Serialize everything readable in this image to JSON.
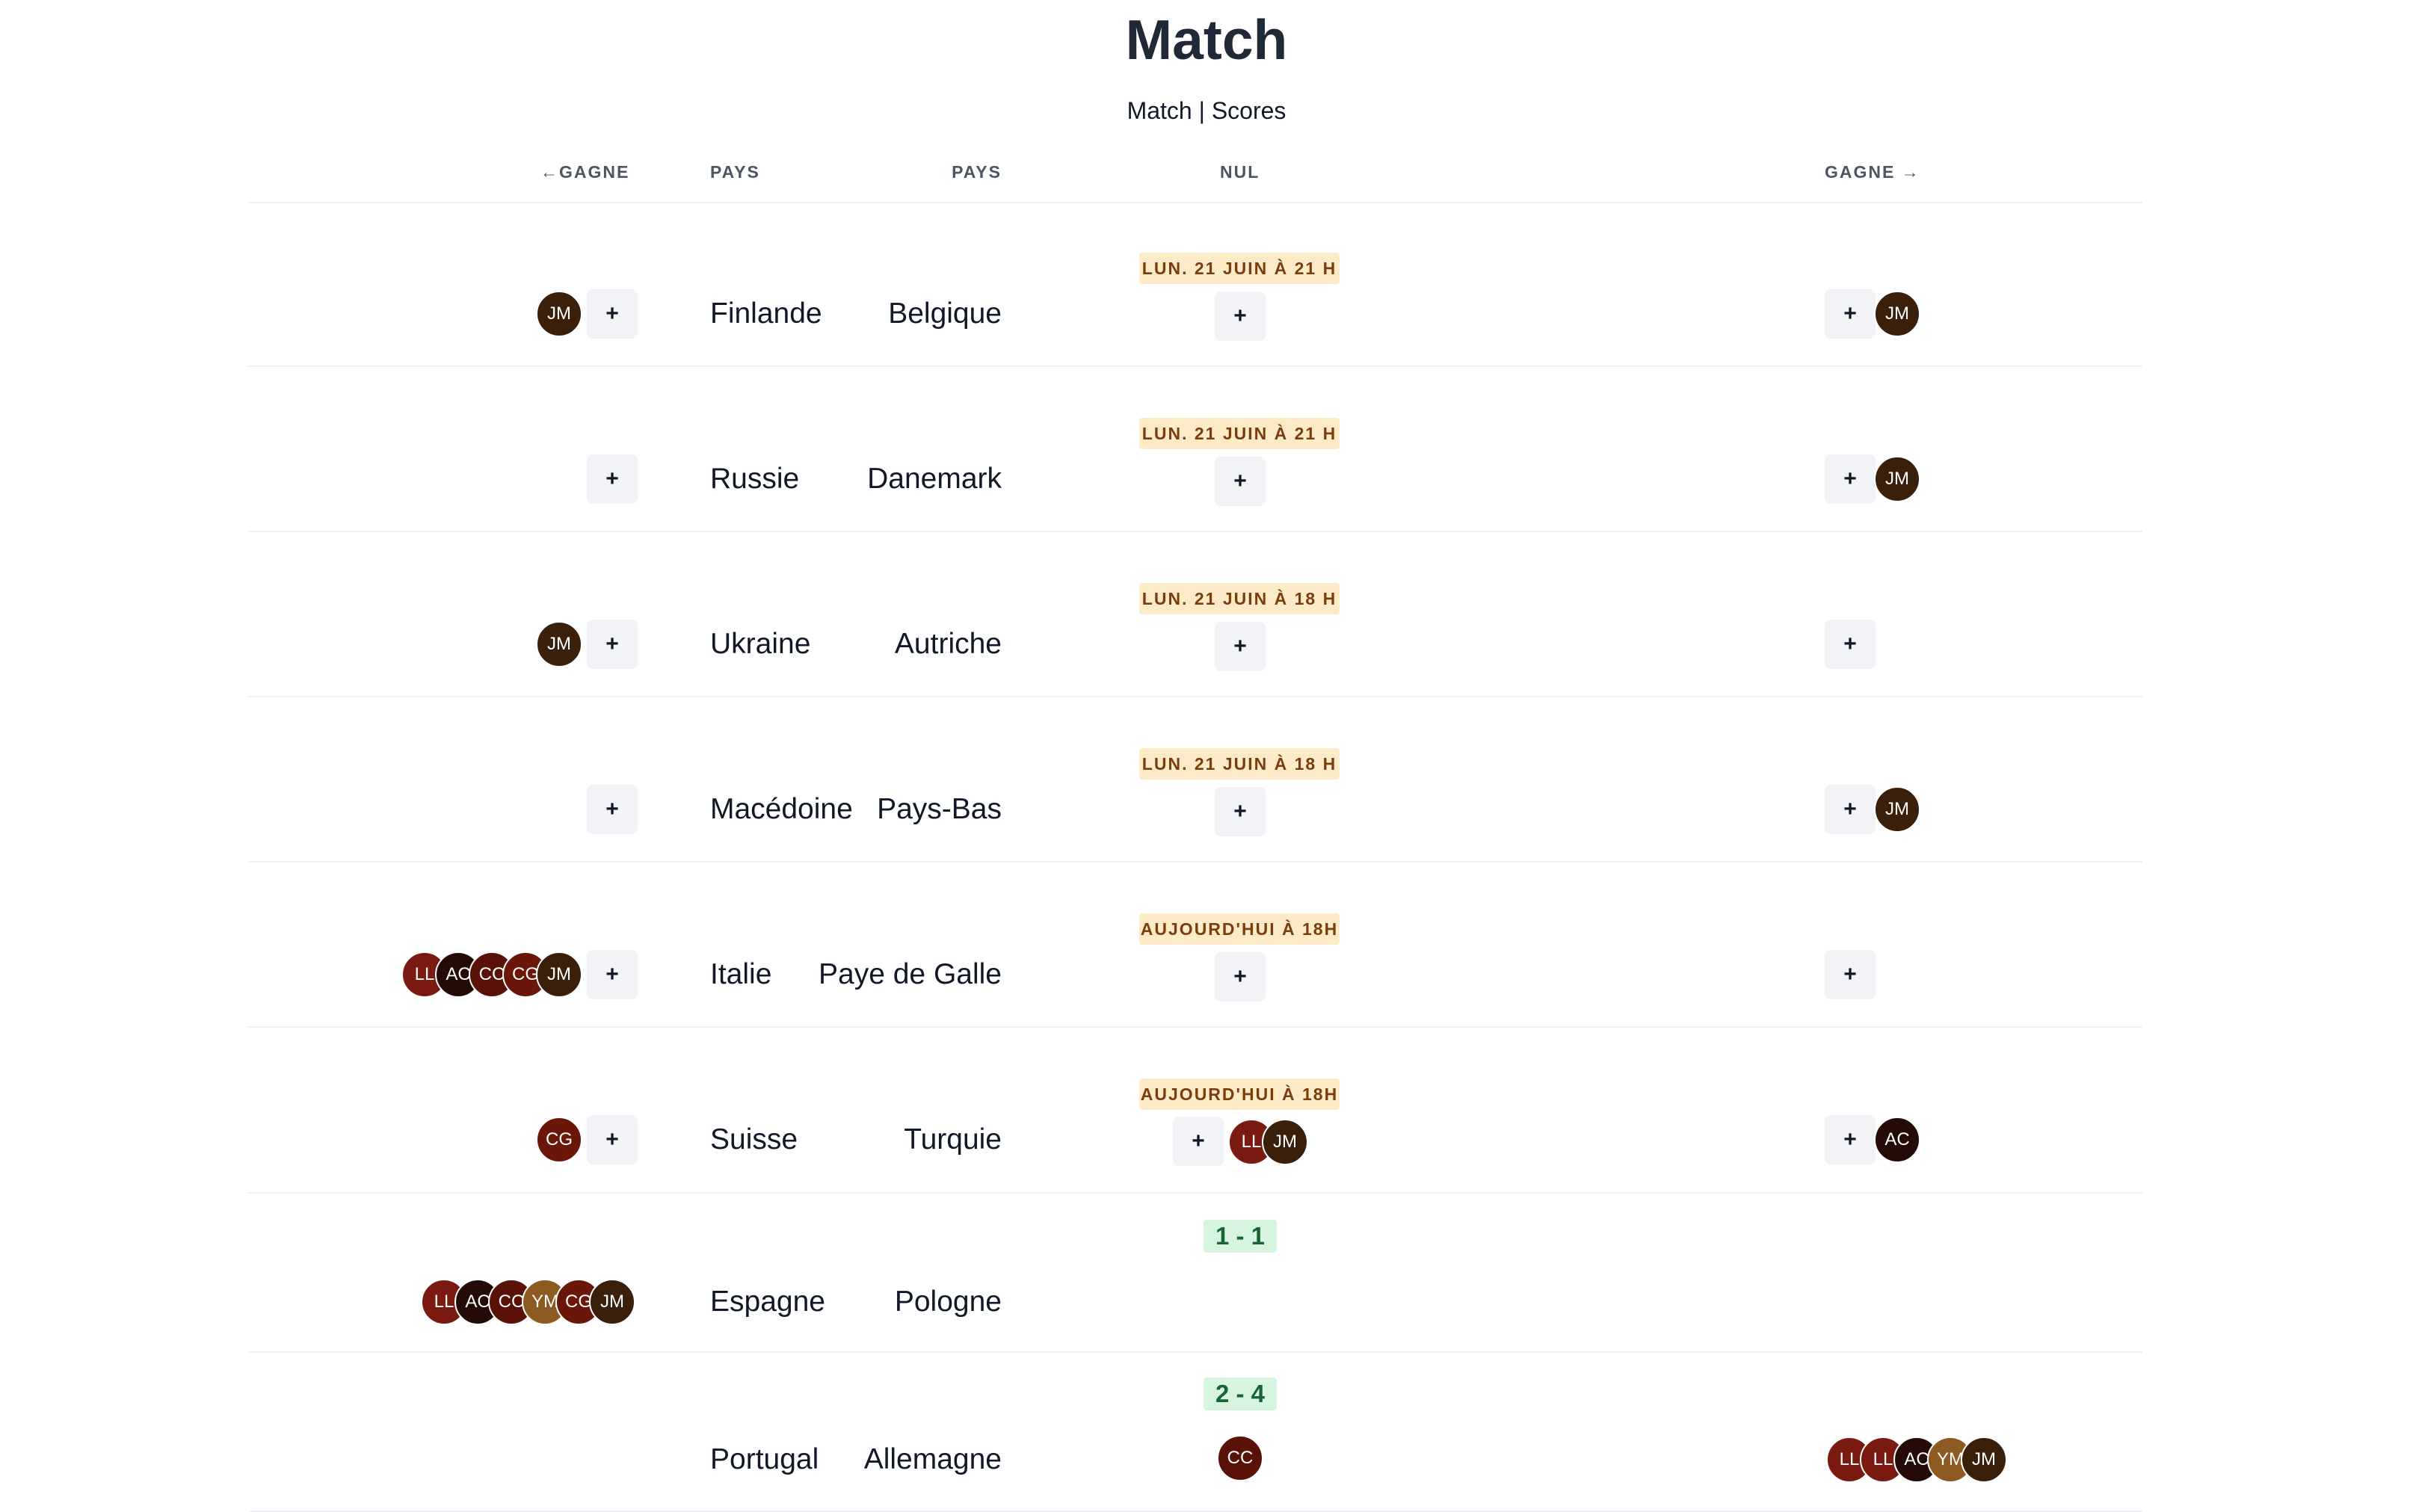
{
  "page": {
    "title": "Match",
    "subtitle": "Match | Scores"
  },
  "columns": {
    "left_win": "GAGNE",
    "left_country": "PAYS",
    "draw": "NUL",
    "right_country": "PAYS",
    "right_win": "GAGNE"
  },
  "add_label": "+",
  "avatar_colors": {
    "LL": "#7a1a10",
    "AC": "#240b05",
    "CC": "#5a1208",
    "CG": "#6a1609",
    "JM": "#3a1f0a",
    "YM": "#8d5a22"
  },
  "matches": [
    {
      "status": "LUN. 21 JUIN À 21 H",
      "left_team": "Finlande",
      "right_team": "Belgique",
      "left_votes": [
        "JM"
      ],
      "draw_votes": [],
      "right_votes": [
        "JM"
      ]
    },
    {
      "status": "LUN. 21 JUIN À 21 H",
      "left_team": "Russie",
      "right_team": "Danemark",
      "left_votes": [],
      "draw_votes": [],
      "right_votes": [
        "JM"
      ]
    },
    {
      "status": "LUN. 21 JUIN À 18 H",
      "left_team": "Ukraine",
      "right_team": "Autriche",
      "left_votes": [
        "JM"
      ],
      "draw_votes": [],
      "right_votes": []
    },
    {
      "status": "LUN. 21 JUIN À 18 H",
      "left_team": "Macédoine",
      "right_team": "Pays-Bas",
      "left_votes": [],
      "draw_votes": [],
      "right_votes": [
        "JM"
      ]
    },
    {
      "status": "AUJOURD'HUI À 18H",
      "left_team": "Italie",
      "right_team": "Paye de Galle",
      "left_votes": [
        "LL",
        "AC",
        "CC",
        "CG",
        "JM"
      ],
      "draw_votes": [],
      "right_votes": []
    },
    {
      "status": "AUJOURD'HUI À 18H",
      "left_team": "Suisse",
      "right_team": "Turquie",
      "left_votes": [
        "CG"
      ],
      "draw_votes": [
        "LL",
        "JM"
      ],
      "right_votes": [
        "AC"
      ]
    },
    {
      "score": "1 - 1",
      "left_team": "Espagne",
      "right_team": "Pologne",
      "left_votes": [
        "LL",
        "AC",
        "CC",
        "YM",
        "CG",
        "JM"
      ],
      "draw_votes": [],
      "right_votes": []
    },
    {
      "score": "2 - 4",
      "left_team": "Portugal",
      "right_team": "Allemagne",
      "left_votes": [],
      "draw_votes": [
        "CC"
      ],
      "right_votes": [
        "LL",
        "LL",
        "AC",
        "YM",
        "JM"
      ]
    }
  ]
}
